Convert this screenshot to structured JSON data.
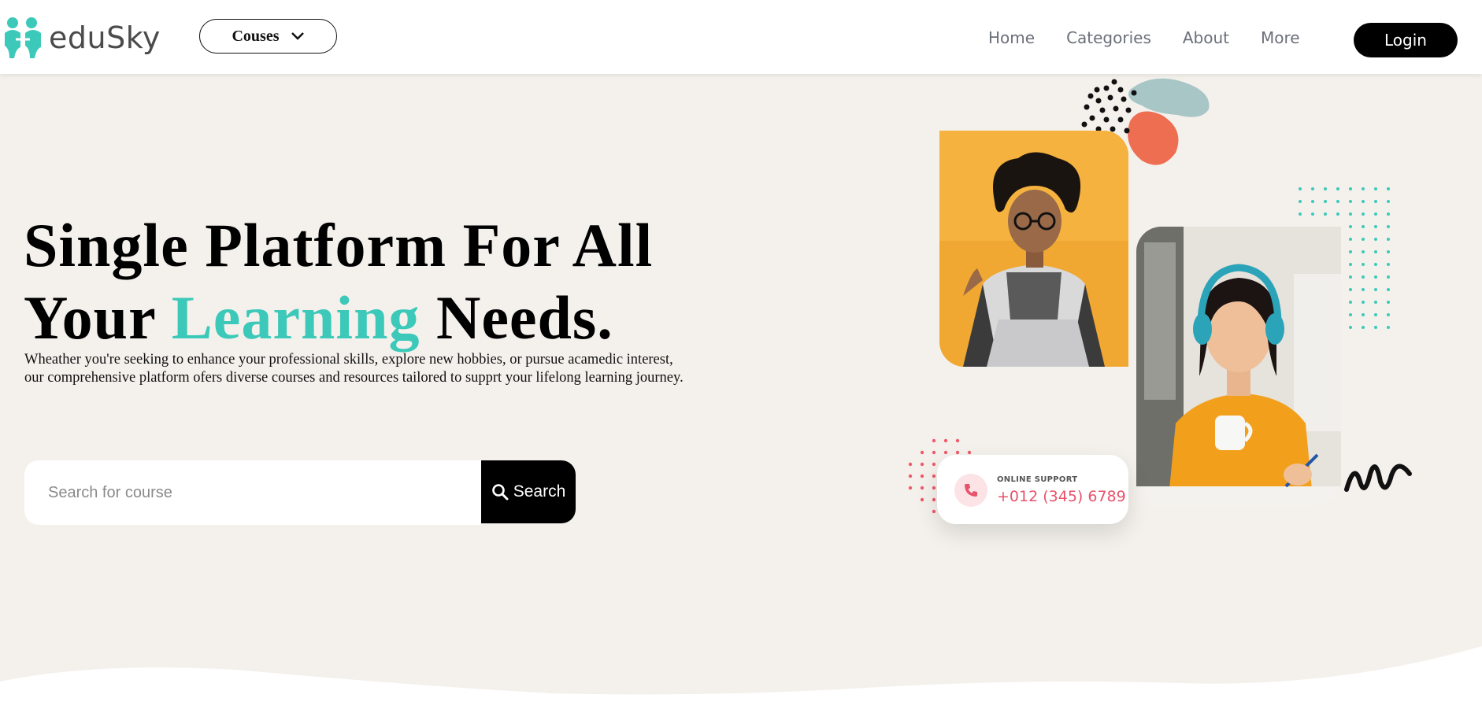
{
  "header": {
    "brand": "eduSky",
    "courses_label": "Couses",
    "nav": [
      "Home",
      "Categories",
      "About",
      "More"
    ],
    "login_label": "Login"
  },
  "hero": {
    "title_line1": "Single Platform For All",
    "title_line2_pre": "Your ",
    "title_line2_accent": "Learning",
    "title_line2_post": " Needs.",
    "description": "Wheather you're seeking to enhance your professional skills, explore new hobbies, or pursue acamedic interest, our comprehensive platform ofers diverse courses and resources tailored to supprt your lifelong learning journey.",
    "search_placeholder": "Search for course",
    "search_label": "Search"
  },
  "support": {
    "label": "ONLINE SUPPORT",
    "phone": "+012 (345) 6789"
  },
  "colors": {
    "accent": "#3cc9b9",
    "hero_bg": "#f4f1ec",
    "phone": "#e8526b"
  },
  "icons": [
    "logo-people-icon",
    "chevron-down-icon",
    "search-icon",
    "phone-icon"
  ]
}
